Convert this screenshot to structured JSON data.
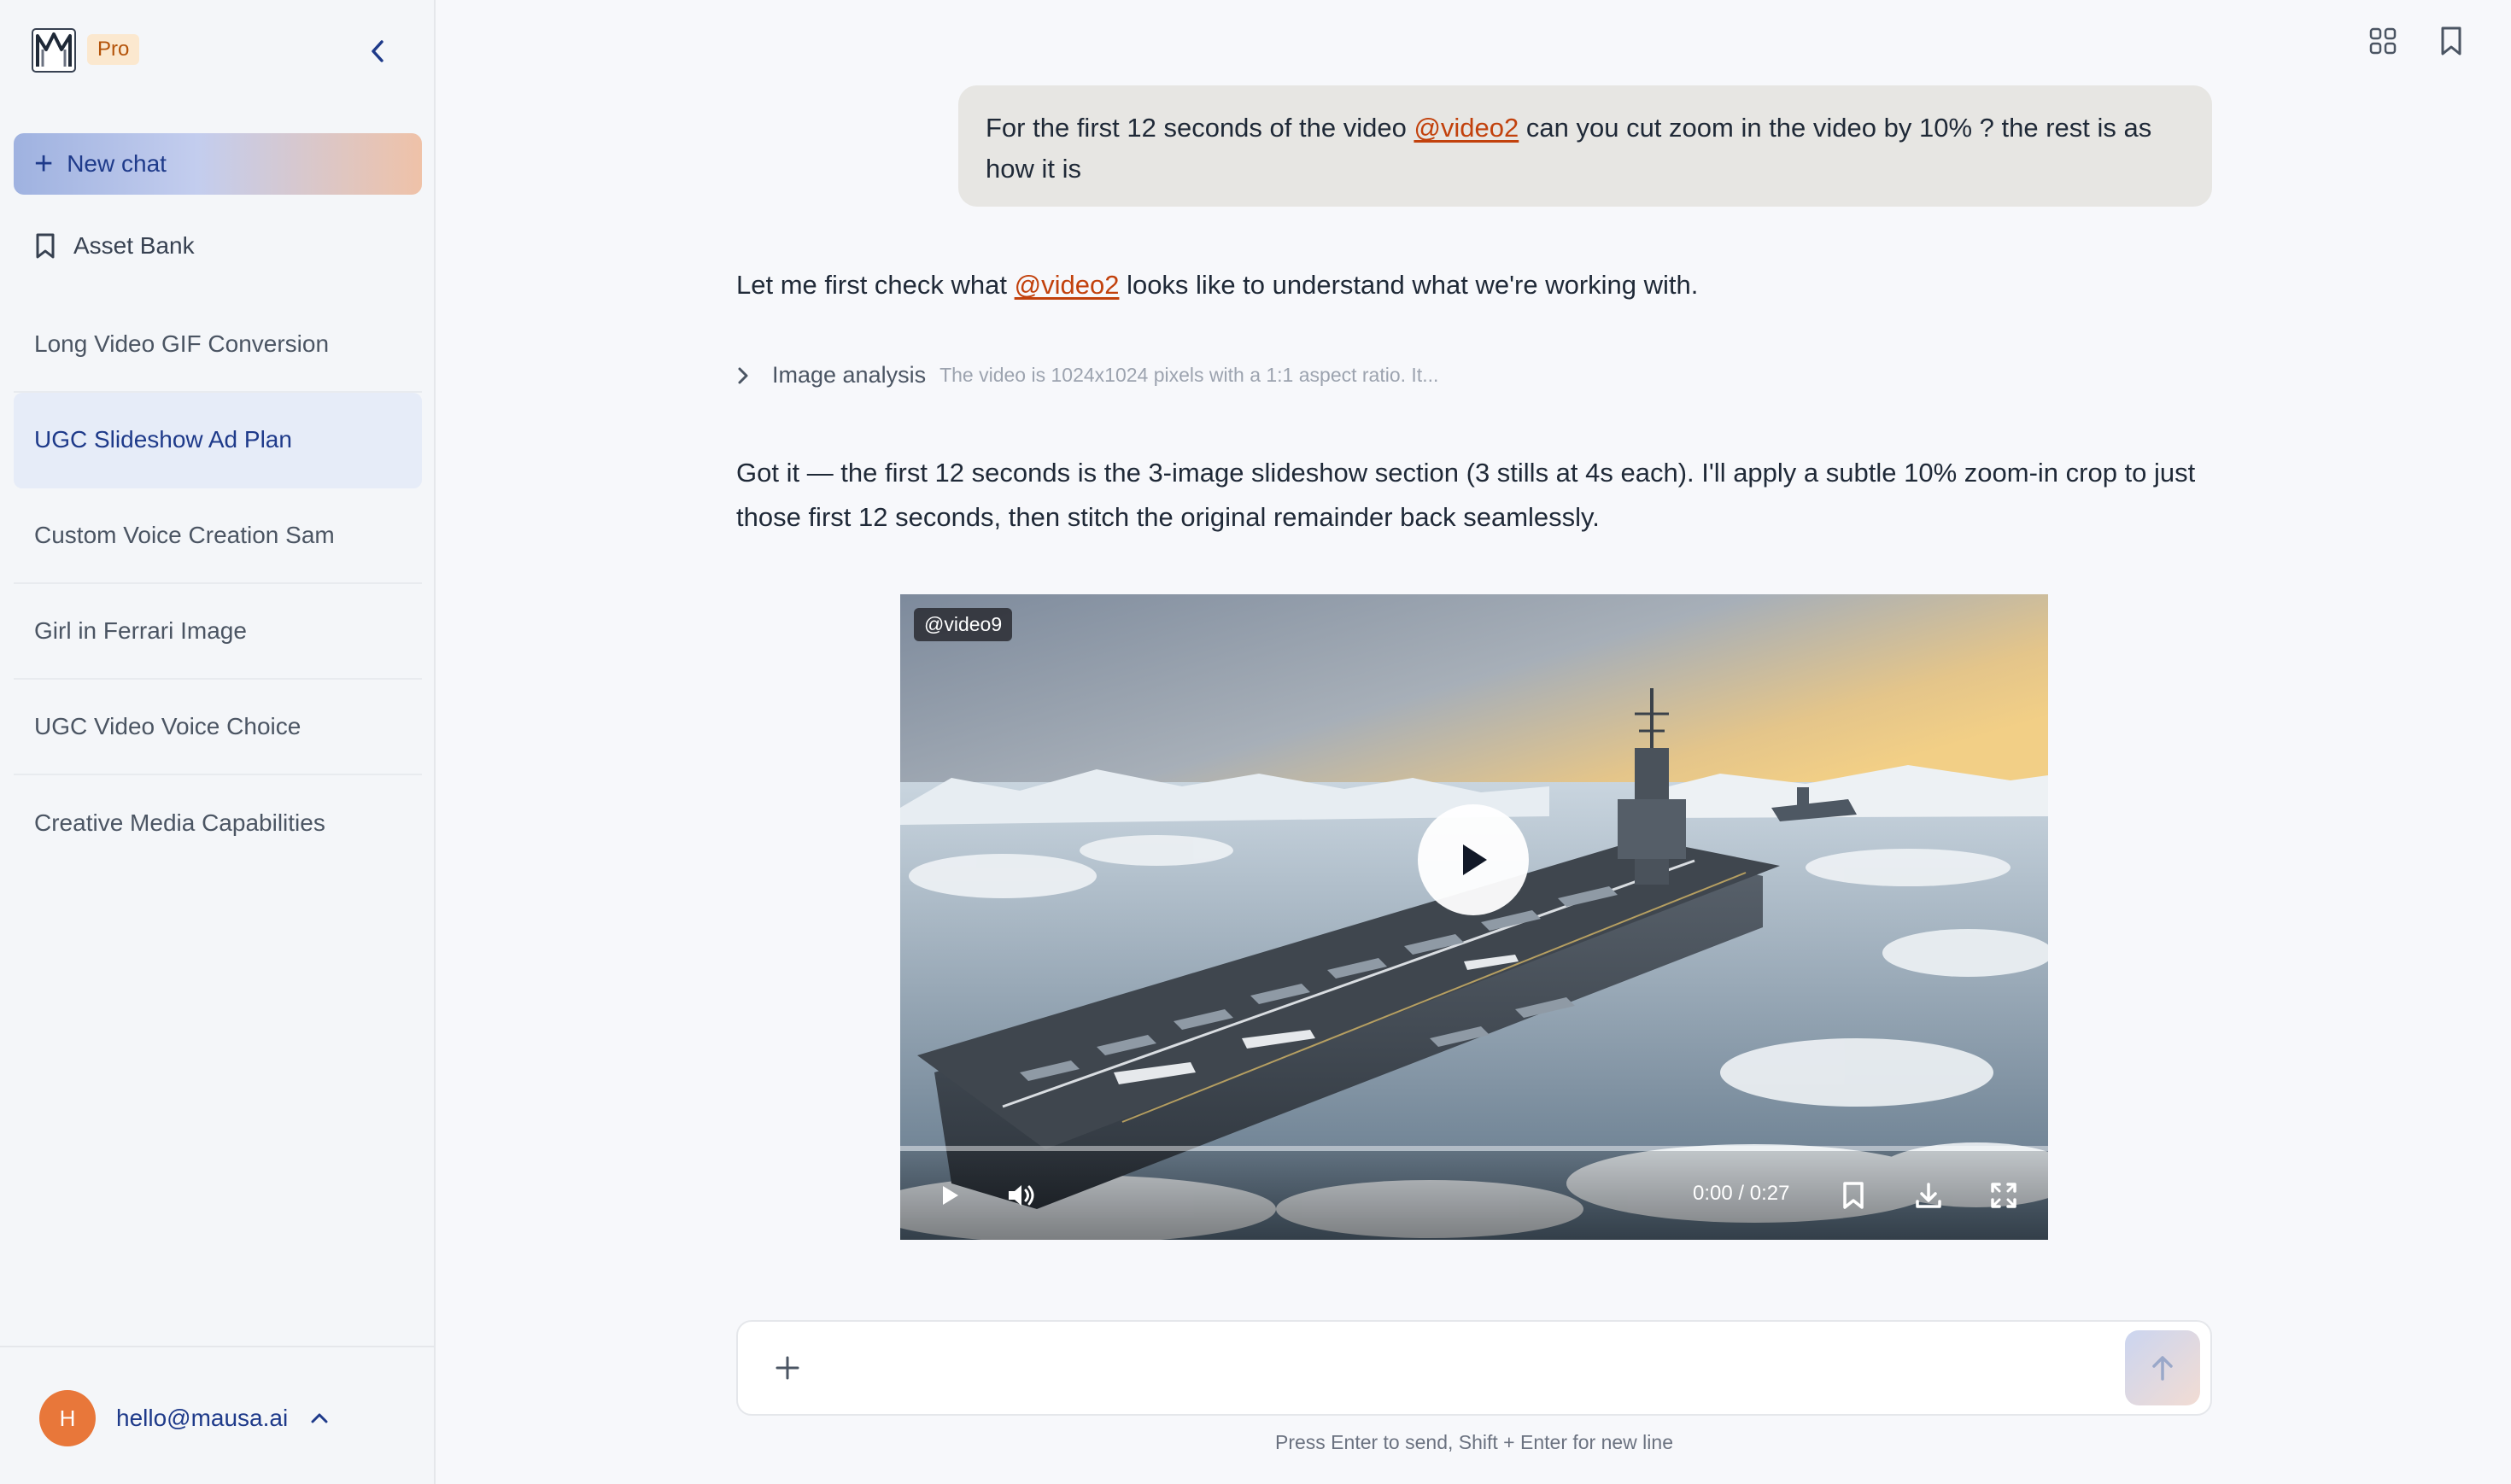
{
  "sidebar": {
    "pro_badge": "Pro",
    "new_chat_label": "New chat",
    "asset_bank_label": "Asset Bank",
    "history": [
      {
        "label": "Long Video GIF Conversion"
      },
      {
        "label": "UGC Slideshow Ad Plan",
        "active": true
      },
      {
        "label": "Custom Voice Creation Sam"
      },
      {
        "label": "Girl in Ferrari Image"
      },
      {
        "label": "UGC Video Voice Choice"
      },
      {
        "label": "Creative Media Capabilities"
      }
    ],
    "user": {
      "initial": "H",
      "email": "hello@mausa.ai"
    }
  },
  "header": {
    "icons": [
      "grid-icon",
      "bookmark-icon"
    ]
  },
  "chat": {
    "user_message": {
      "text_before": "For the first 12 seconds of the video ",
      "mention": "@video2",
      "text_after": " can you cut zoom in the video by 10% ? the rest is as how it is"
    },
    "assistant_intro": {
      "text_before": "Let me first check what ",
      "mention": "@video2",
      "text_after": " looks like to understand what we're working with."
    },
    "analysis": {
      "label": "Image analysis",
      "summary": "The video is 1024x1024 pixels with a 1:1 aspect ratio. It..."
    },
    "assistant_reply": "Got it — the first 12 seconds is the 3-image slideshow section (3 stills at 4s each). I'll apply a subtle 10% zoom-in crop to just those first 12 seconds, then stitch the original remainder back seamlessly.",
    "video": {
      "tag": "@video9",
      "time": "0:00 / 0:27",
      "progress_fraction": 0.0
    }
  },
  "composer": {
    "value": "",
    "placeholder": "",
    "hint": "Press Enter to send, Shift + Enter for new line"
  },
  "colors": {
    "accent": "#1e3a8a",
    "mention": "#c2410c",
    "pro_badge_bg": "#fbe8cf",
    "avatar": "#e8773a"
  }
}
